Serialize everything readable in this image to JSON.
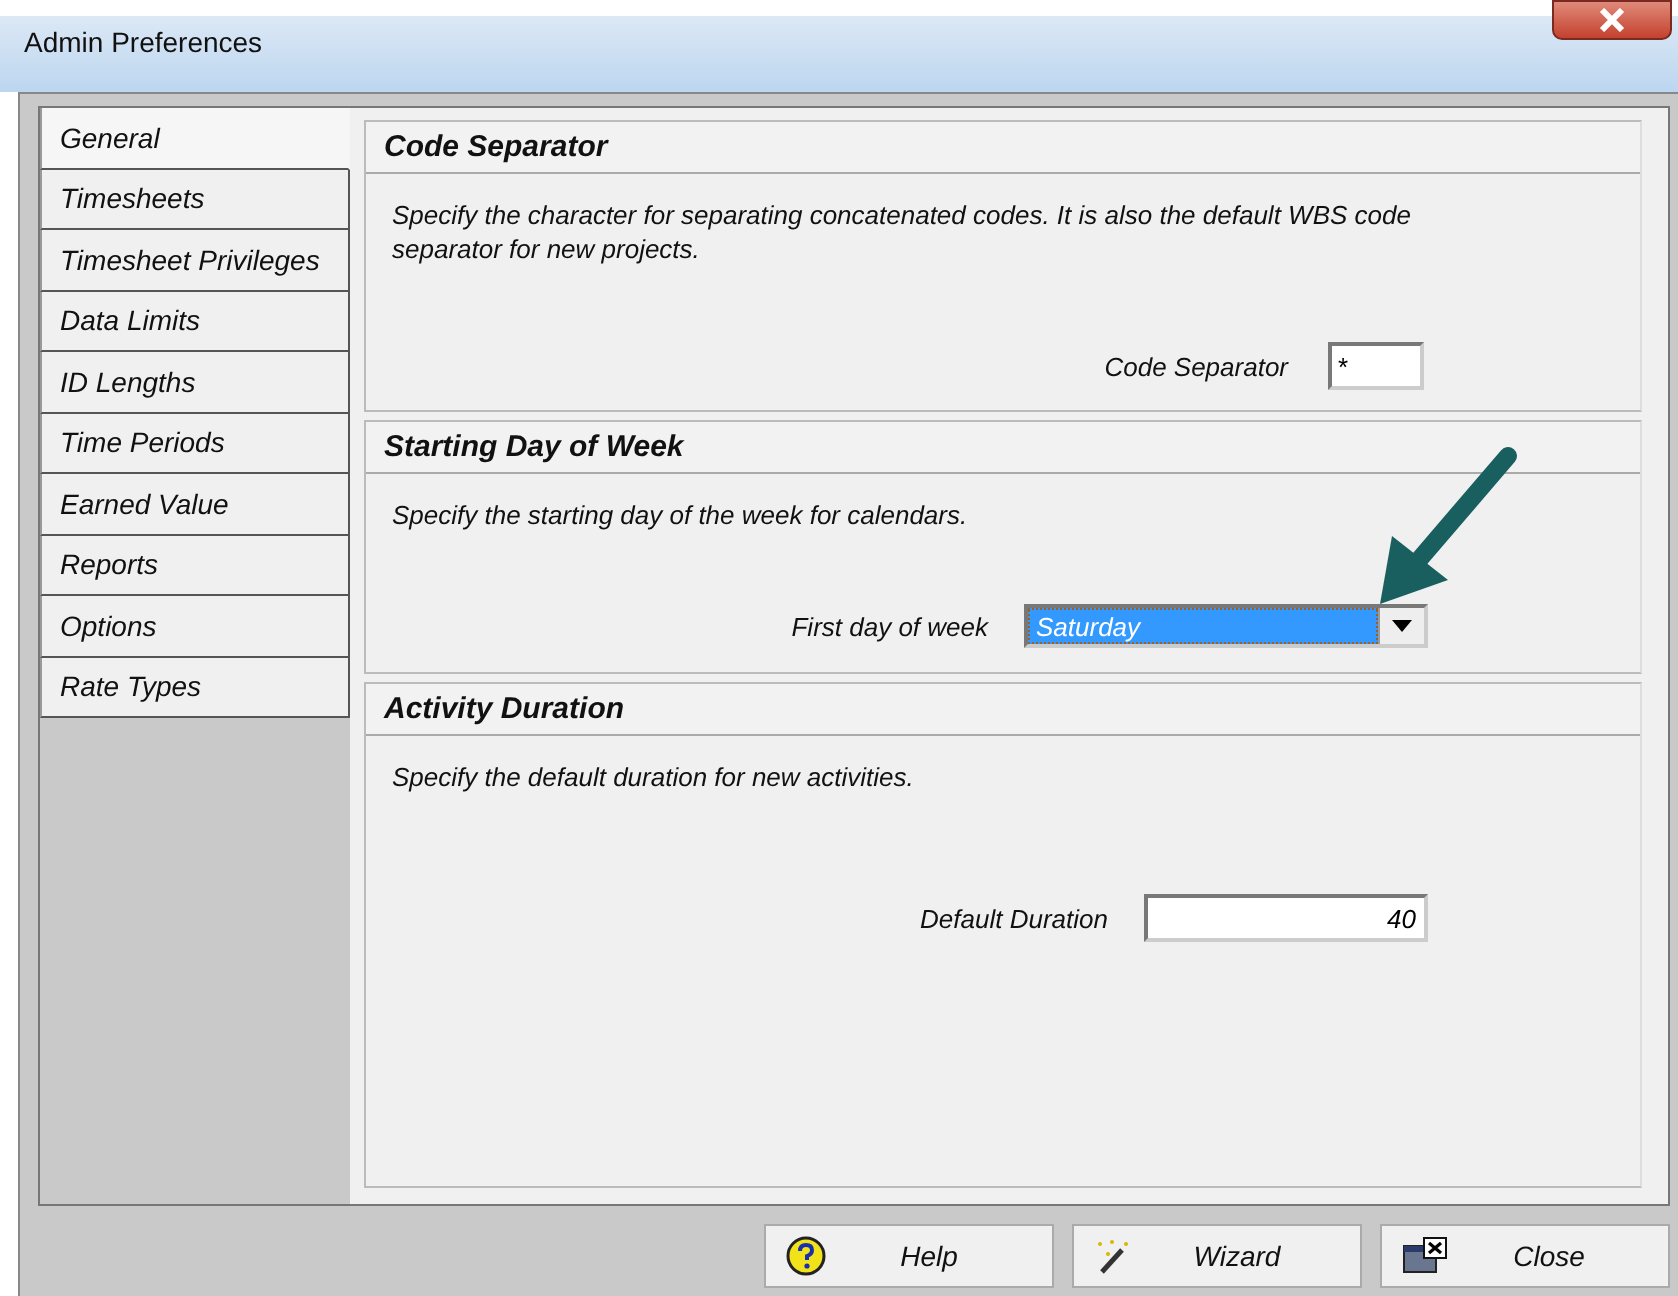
{
  "window": {
    "title": "Admin Preferences"
  },
  "tabs": [
    {
      "label": "General",
      "selected": true
    },
    {
      "label": "Timesheets",
      "selected": false
    },
    {
      "label": "Timesheet Privileges",
      "selected": false
    },
    {
      "label": "Data Limits",
      "selected": false
    },
    {
      "label": "ID Lengths",
      "selected": false
    },
    {
      "label": "Time Periods",
      "selected": false
    },
    {
      "label": "Earned Value",
      "selected": false
    },
    {
      "label": "Reports",
      "selected": false
    },
    {
      "label": "Options",
      "selected": false
    },
    {
      "label": "Rate Types",
      "selected": false
    }
  ],
  "sections": [
    {
      "title": "Code Separator",
      "description": "Specify the character for separating concatenated codes.  It is also the default WBS code separator for new projects.",
      "field": {
        "kind": "text",
        "label": "Code Separator",
        "value": "*"
      }
    },
    {
      "title": "Starting Day of Week",
      "description": "Specify the starting day of the week for calendars.",
      "field": {
        "kind": "dropdown",
        "label": "First day of week",
        "value": "Saturday"
      }
    },
    {
      "title": "Activity Duration",
      "description": "Specify the default duration for new activities.",
      "field": {
        "kind": "number",
        "label": "Default Duration",
        "value": "40"
      }
    }
  ],
  "buttons": [
    {
      "label": "Help",
      "kind": "help"
    },
    {
      "label": "Wizard",
      "kind": "wizard"
    },
    {
      "label": "Close",
      "kind": "close"
    }
  ]
}
